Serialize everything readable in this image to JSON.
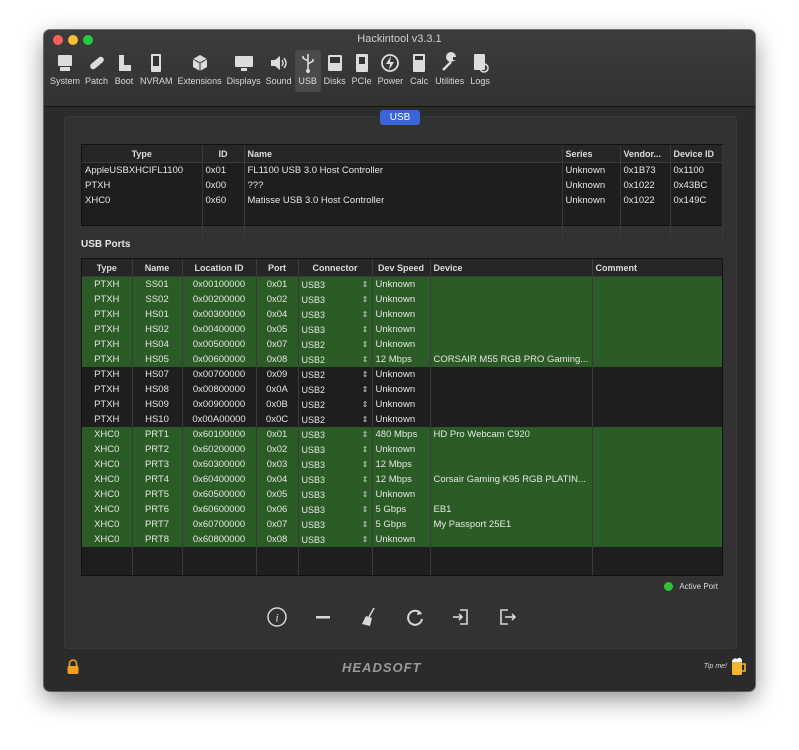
{
  "window": {
    "title": "Hackintool v3.3.1"
  },
  "toolbar": {
    "items": [
      {
        "label": "System",
        "icon": "system-icon"
      },
      {
        "label": "Patch",
        "icon": "patch-icon"
      },
      {
        "label": "Boot",
        "icon": "boot-icon"
      },
      {
        "label": "NVRAM",
        "icon": "nvram-icon"
      },
      {
        "label": "Extensions",
        "icon": "extensions-icon"
      },
      {
        "label": "Displays",
        "icon": "displays-icon"
      },
      {
        "label": "Sound",
        "icon": "sound-icon"
      },
      {
        "label": "USB",
        "icon": "usb-icon",
        "active": true
      },
      {
        "label": "Disks",
        "icon": "disks-icon"
      },
      {
        "label": "PCIe",
        "icon": "pcie-icon"
      },
      {
        "label": "Power",
        "icon": "power-icon"
      },
      {
        "label": "Calc",
        "icon": "calc-icon"
      },
      {
        "label": "Utilities",
        "icon": "utilities-icon"
      },
      {
        "label": "Logs",
        "icon": "logs-icon"
      }
    ]
  },
  "tab": {
    "label": "USB"
  },
  "controllers": {
    "headers": [
      "Type",
      "ID",
      "Name",
      "Series",
      "Vendor...",
      "Device ID"
    ],
    "rows": [
      [
        "AppleUSBXHCIFL1100",
        "0x01",
        "FL1100 USB 3.0 Host Controller",
        "Unknown",
        "0x1B73",
        "0x1100"
      ],
      [
        "PTXH",
        "0x00",
        "???",
        "Unknown",
        "0x1022",
        "0x43BC"
      ],
      [
        "XHC0",
        "0x60",
        "Matisse USB 3.0 Host Controller",
        "Unknown",
        "0x1022",
        "0x149C"
      ]
    ]
  },
  "ports": {
    "title": "USB Ports",
    "headers": [
      "Type",
      "Name",
      "Location ID",
      "Port",
      "Connector",
      "Dev Speed",
      "Device",
      "Comment"
    ],
    "rows": [
      {
        "cells": [
          "PTXH",
          "SS01",
          "0x00100000",
          "0x01",
          "USB3",
          "Unknown",
          "",
          ""
        ],
        "active": true
      },
      {
        "cells": [
          "PTXH",
          "SS02",
          "0x00200000",
          "0x02",
          "USB3",
          "Unknown",
          "",
          ""
        ],
        "active": true
      },
      {
        "cells": [
          "PTXH",
          "HS01",
          "0x00300000",
          "0x04",
          "USB3",
          "Unknown",
          "",
          ""
        ],
        "active": true
      },
      {
        "cells": [
          "PTXH",
          "HS02",
          "0x00400000",
          "0x05",
          "USB3",
          "Unknown",
          "",
          ""
        ],
        "active": true
      },
      {
        "cells": [
          "PTXH",
          "HS04",
          "0x00500000",
          "0x07",
          "USB2",
          "Unknown",
          "",
          ""
        ],
        "active": true
      },
      {
        "cells": [
          "PTXH",
          "HS05",
          "0x00600000",
          "0x08",
          "USB2",
          "12 Mbps",
          "CORSAIR M55 RGB PRO Gaming...",
          ""
        ],
        "active": true
      },
      {
        "cells": [
          "PTXH",
          "HS07",
          "0x00700000",
          "0x09",
          "USB2",
          "Unknown",
          "",
          ""
        ],
        "active": false
      },
      {
        "cells": [
          "PTXH",
          "HS08",
          "0x00800000",
          "0x0A",
          "USB2",
          "Unknown",
          "",
          ""
        ],
        "active": false
      },
      {
        "cells": [
          "PTXH",
          "HS09",
          "0x00900000",
          "0x0B",
          "USB2",
          "Unknown",
          "",
          ""
        ],
        "active": false
      },
      {
        "cells": [
          "PTXH",
          "HS10",
          "0x00A00000",
          "0x0C",
          "USB2",
          "Unknown",
          "",
          ""
        ],
        "active": false
      },
      {
        "cells": [
          "XHC0",
          "PRT1",
          "0x60100000",
          "0x01",
          "USB3",
          "480 Mbps",
          "HD Pro Webcam C920",
          ""
        ],
        "active": true
      },
      {
        "cells": [
          "XHC0",
          "PRT2",
          "0x60200000",
          "0x02",
          "USB3",
          "Unknown",
          "",
          ""
        ],
        "active": true
      },
      {
        "cells": [
          "XHC0",
          "PRT3",
          "0x60300000",
          "0x03",
          "USB3",
          "12 Mbps",
          "",
          ""
        ],
        "active": true
      },
      {
        "cells": [
          "XHC0",
          "PRT4",
          "0x60400000",
          "0x04",
          "USB3",
          "12 Mbps",
          "Corsair Gaming K95 RGB PLATIN...",
          ""
        ],
        "active": true
      },
      {
        "cells": [
          "XHC0",
          "PRT5",
          "0x60500000",
          "0x05",
          "USB3",
          "Unknown",
          "",
          ""
        ],
        "active": true
      },
      {
        "cells": [
          "XHC0",
          "PRT6",
          "0x60600000",
          "0x06",
          "USB3",
          "5 Gbps",
          "EB1",
          ""
        ],
        "active": true
      },
      {
        "cells": [
          "XHC0",
          "PRT7",
          "0x60700000",
          "0x07",
          "USB3",
          "5 Gbps",
          "My Passport 25E1",
          ""
        ],
        "active": true
      },
      {
        "cells": [
          "XHC0",
          "PRT8",
          "0x60800000",
          "0x08",
          "USB3",
          "Unknown",
          "",
          ""
        ],
        "active": true
      }
    ]
  },
  "legend": {
    "label": "Active Port",
    "color": "#33c13c"
  },
  "actions": [
    {
      "name": "info-button",
      "icon": "info-icon"
    },
    {
      "name": "remove-button",
      "icon": "minus-icon"
    },
    {
      "name": "clear-button",
      "icon": "broom-icon"
    },
    {
      "name": "refresh-button",
      "icon": "refresh-icon"
    },
    {
      "name": "import-button",
      "icon": "import-icon"
    },
    {
      "name": "export-button",
      "icon": "export-icon"
    }
  ],
  "footer": {
    "brand": "HEADSOFT",
    "tip": "Tip me!"
  },
  "colors": {
    "active_row": "#2b5c25",
    "accent": "#3a64d8",
    "panel": "#323232"
  }
}
